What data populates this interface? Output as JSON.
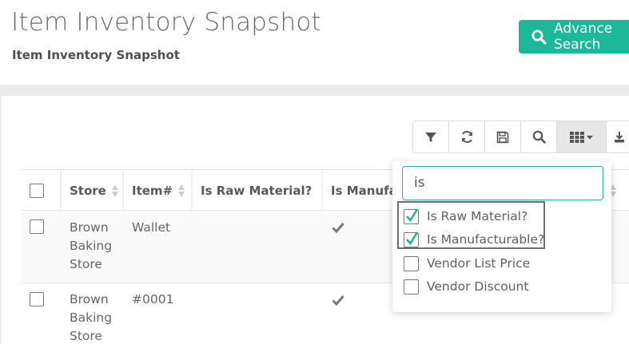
{
  "page": {
    "title": "Item Inventory Snapshot",
    "subtitle": "Item Inventory Snapshot"
  },
  "advance_search": {
    "label": "Advance Search"
  },
  "toolbar": {
    "buttons": [
      "filter-icon",
      "refresh-icon",
      "save-icon",
      "search-icon",
      "columns-icon",
      "export-icon"
    ]
  },
  "table": {
    "columns": [
      "Store",
      "Item#",
      "Is Raw Material?",
      "Is Manufacturable?"
    ],
    "rows": [
      {
        "store": [
          "Brown",
          "Baking",
          "Store"
        ],
        "item": "Wallet",
        "is_raw_material": false,
        "is_manufacturable": true
      },
      {
        "store": [
          "Brown",
          "Baking",
          "Store"
        ],
        "item": "#0001",
        "is_raw_material": false,
        "is_manufacturable": true
      }
    ]
  },
  "column_picker": {
    "search_value": "is",
    "options": [
      {
        "label": "Is Raw Material?",
        "checked": true
      },
      {
        "label": "Is Manufacturable?",
        "checked": true
      },
      {
        "label": "Vendor List Price",
        "checked": false
      },
      {
        "label": "Vendor Discount",
        "checked": false
      }
    ]
  },
  "colors": {
    "accent": "#1bb99a",
    "check": "#1bb99a"
  }
}
